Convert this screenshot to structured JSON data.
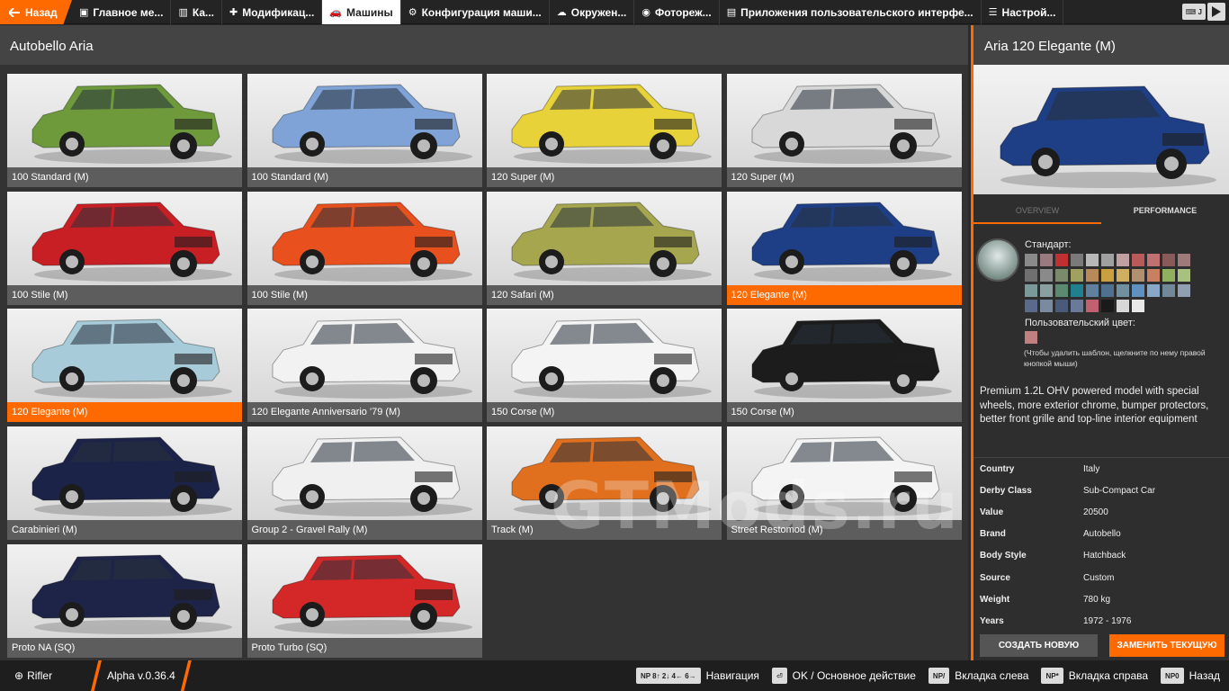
{
  "topbar": {
    "back_label": "Назад",
    "tabs": [
      {
        "label": "Главное ме...",
        "icon": "home-icon"
      },
      {
        "label": "Ка...",
        "icon": "map-icon"
      },
      {
        "label": "Модификац...",
        "icon": "puzzle-icon"
      },
      {
        "label": "Машины",
        "icon": "car-icon",
        "active": true
      },
      {
        "label": "Конфигурация маши...",
        "icon": "engine-icon"
      },
      {
        "label": "Окружен...",
        "icon": "weather-icon"
      },
      {
        "label": "Фотореж...",
        "icon": "camera-icon"
      },
      {
        "label": "Приложения пользовательского интерфе...",
        "icon": "apps-icon"
      },
      {
        "label": "Настрой...",
        "icon": "sliders-icon"
      }
    ],
    "key_badge": "J"
  },
  "left": {
    "title": "Autobello Aria"
  },
  "cars": [
    {
      "label": "100 Standard (M)",
      "color": "#6e9a3c"
    },
    {
      "label": "100 Standard (M)",
      "color": "#7fa3d6"
    },
    {
      "label": "120 Super (M)",
      "color": "#e8d23a"
    },
    {
      "label": "120 Super (M)",
      "color": "#d8d8d8"
    },
    {
      "label": "100 Stile (M)",
      "color": "#c81f24"
    },
    {
      "label": "100 Stile (M)",
      "color": "#e8501e"
    },
    {
      "label": "120 Safari (M)",
      "color": "#a6a64e"
    },
    {
      "label": "120 Elegante (M)",
      "color": "#1e3f86",
      "selected": true
    },
    {
      "label": "120 Elegante (M)",
      "color": "#a7cbd8",
      "selected": true
    },
    {
      "label": "120 Elegante Anniversario '79 (M)",
      "color": "#f2f2f2"
    },
    {
      "label": "150 Corse (M)",
      "color": "#f4f4f4"
    },
    {
      "label": "150 Corse (M)",
      "color": "#1c1c1c"
    },
    {
      "label": "Carabinieri (M)",
      "color": "#1c2348"
    },
    {
      "label": "Group 2 - Gravel Rally (M)",
      "color": "#f0f0f0"
    },
    {
      "label": "Track (M)",
      "color": "#e0701e"
    },
    {
      "label": "Street Restomod (M)",
      "color": "#f4f4f4"
    },
    {
      "label": "Proto NA (SQ)",
      "color": "#1e2448"
    },
    {
      "label": "Proto Turbo (SQ)",
      "color": "#d42828"
    }
  ],
  "details": {
    "title": "Aria 120 Elegante (M)",
    "preview_color": "#1e3f86",
    "tabs": [
      "OVERVIEW",
      "PERFORMANCE"
    ],
    "standard_label": "Стандарт:",
    "custom_label": "Пользовательский цвет:",
    "hint": "(Чтобы удалить шаблон, щелкните по нему правой кнопкой мыши)",
    "description": "Premium 1.2L OHV powered model with special wheels, more exterior chrome, bumper protectors, better front grille and top-line interior equipment",
    "swatches": [
      "#8a8a8a",
      "#9a7a80",
      "#c03030",
      "#7a7a7a",
      "#b8b8b8",
      "#a0a0a0",
      "#c0a0a0",
      "#b85a5a",
      "#c07070",
      "#8a5a5a",
      "#a07a7a",
      "#707070",
      "#8a8a8a",
      "#7a8a6a",
      "#a0a060",
      "#b88a5a",
      "#c8a040",
      "#d0b060",
      "#b09070",
      "#c88060",
      "#90b060",
      "#a8c080",
      "#7a9a9a",
      "#8aa0a0",
      "#5a8a70",
      "#208090",
      "#6080a0",
      "#507090",
      "#7090a0",
      "#6090c0",
      "#88a8c8",
      "#708898",
      "#90a0b0",
      "#5a6a8a",
      "#7a8aa0",
      "#4a5a7a",
      "#6a7a9a",
      "#c06070",
      "#1a1a1a",
      "#d8d8d8",
      "#e8e8e8"
    ],
    "specs": [
      {
        "k": "Country",
        "v": "Italy"
      },
      {
        "k": "Derby Class",
        "v": "Sub-Compact Car"
      },
      {
        "k": "Value",
        "v": "20500"
      },
      {
        "k": "Brand",
        "v": "Autobello"
      },
      {
        "k": "Body Style",
        "v": "Hatchback"
      },
      {
        "k": "Source",
        "v": "Custom"
      },
      {
        "k": "Weight",
        "v": "780 kg"
      },
      {
        "k": "Years",
        "v": "1972 - 1976"
      }
    ],
    "create_label": "СОЗДАТЬ НОВУЮ",
    "replace_label": "ЗАМЕНИТЬ ТЕКУЩУЮ"
  },
  "bottombar": {
    "user": "Rifler",
    "version": "Alpha v.0.36.4",
    "hints": [
      {
        "keys": "NP 8↑ 2↓ 4← 6→",
        "label": "Навигация"
      },
      {
        "keys": "⏎",
        "label": "OK / Основное действие"
      },
      {
        "keys": "NP/",
        "label": "Вкладка слева"
      },
      {
        "keys": "NP*",
        "label": "Вкладка справа"
      },
      {
        "keys": "NP0",
        "label": "Назад"
      }
    ]
  },
  "watermark": "GTMods.ru"
}
